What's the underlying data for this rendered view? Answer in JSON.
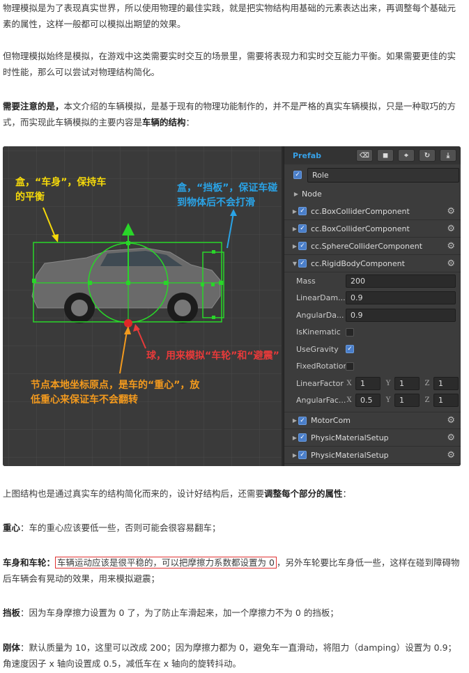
{
  "article": {
    "p1": "物理模拟是为了表现真实世界，所以使用物理的最佳实践，就是把实物结构用基础的元素表达出来，再调整每个基础元素的属性，这样一般都可以模拟出期望的效果。",
    "p2": "但物理模拟始终是模拟，在游戏中这类需要实时交互的场景里，需要将表现力和实时交互能力平衡。如果需要更佳的实时性能，那么可以尝试对物理结构简化。",
    "p3_bold": "需要注意的是，",
    "p3_text": "本文介绍的车辆模拟，是基于现有的物理功能制作的，并不是严格的真实车辆模拟，只是一种取巧的方式，而实现此车辆模拟的主要内容是",
    "p3_bold2": "车辆的结构",
    "p3_end": "：",
    "p4_text": "上图结构也是通过真实车的结构简化而来的，设计好结构后，还需要",
    "p4_bold": "调整每个部分的属性",
    "p4_end": "：",
    "p5_label": "重心",
    "p5_text": "：车的重心应该要低一些，否则可能会很容易翻车；",
    "p6_label": "车身和车轮",
    "p6_colon": "：",
    "p6_highlight": "车辆运动应该是很平稳的，可以把摩擦力系数都设置为 0",
    "p6_text": "，另外车轮要比车身低一些，这样在碰到障碍物后车辆会有晃动的效果，用来模拟避震；",
    "p7_label": "挡板",
    "p7_text": "：因为车身摩擦力设置为 0 了，为了防止车滑起来，加一个摩擦力不为 0 的挡板；",
    "p8_label": "刚体",
    "p8_text": "：默认质量为 10，这里可以改成 200；因为摩擦力都为 0，避免车一直滑动，将阻力（damping）设置为 0.9；角速度因子 x 轴向设置成 0.5，减低车在 x 轴向的旋转抖动。"
  },
  "scene": {
    "ann_body": [
      "盒，“车身”，保持车",
      "的平衡"
    ],
    "ann_body_color": "#f5d90a",
    "ann_baffle": [
      "盒，“挡板”，保证车碰",
      "到物体后不会打滑"
    ],
    "ann_baffle_color": "#2aa3e6",
    "ann_ball": "球，用来模拟“车轮”和“避震”",
    "ann_ball_color": "#e83a3a",
    "ann_origin": [
      "节点本地坐标原点，是车的“重心”，放",
      "低重心来保证车不会翻转"
    ],
    "ann_origin_color": "#f39a1e"
  },
  "panel": {
    "title": "Prefab",
    "accent": "#37a0e6",
    "node_name": "Role",
    "node_section": "Node",
    "components": [
      {
        "label": "cc.BoxColliderComponent"
      },
      {
        "label": "cc.BoxColliderComponent"
      },
      {
        "label": "cc.SphereColliderComponent"
      },
      {
        "label": "cc.RigidBodyComponent"
      }
    ],
    "fields": {
      "mass_label": "Mass",
      "mass": "200",
      "lin_label": "LinearDam...",
      "lin": "0.9",
      "ang_label": "AngularDa...",
      "ang": "0.9",
      "kin_label": "IsKinematic",
      "grav_label": "UseGravity",
      "rot_label": "FixedRotation",
      "lf_label": "LinearFactor",
      "lf_x": "1",
      "lf_y": "1",
      "lf_z": "1",
      "af_label": "AngularFac...",
      "af_x": "0.5",
      "af_y": "1",
      "af_z": "1",
      "x": "X",
      "y": "Y",
      "z": "Z"
    },
    "bottom_components": [
      {
        "label": "MotorCom"
      },
      {
        "label": "PhysicMaterialSetup"
      },
      {
        "label": "PhysicMaterialSetup"
      }
    ]
  }
}
